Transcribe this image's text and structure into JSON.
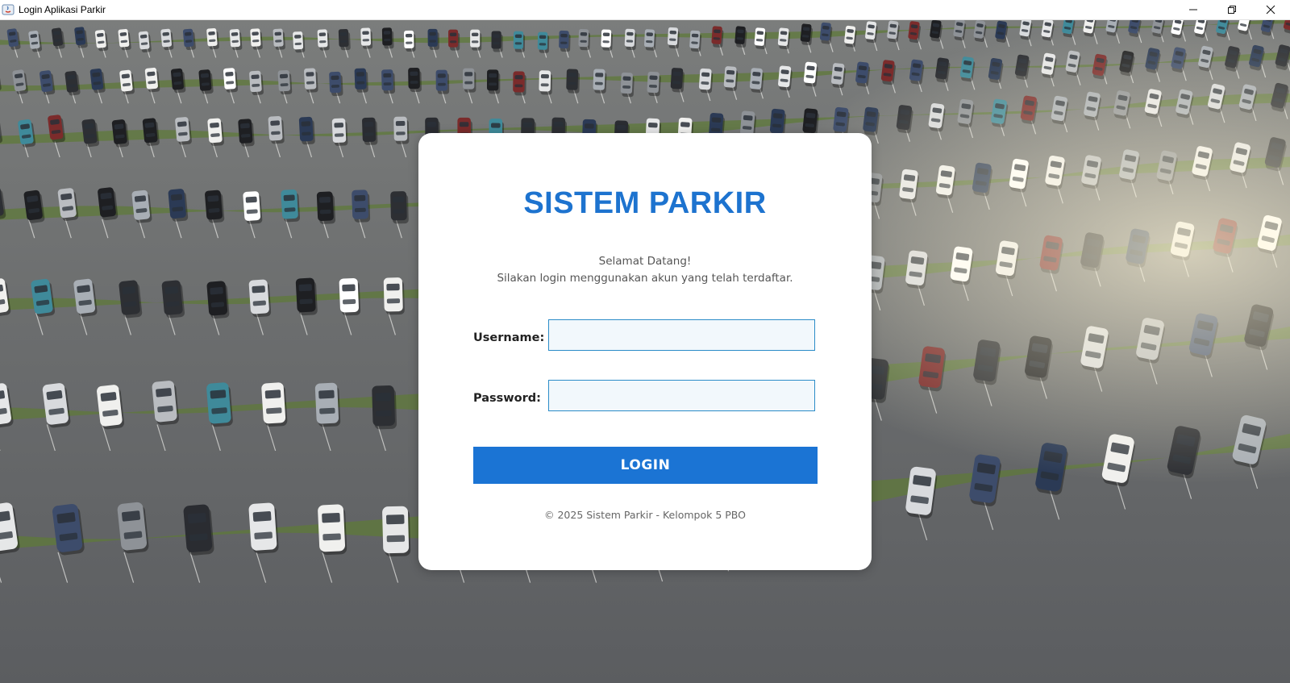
{
  "window": {
    "title": "Login Aplikasi Parkir",
    "icons": {
      "app": "java-app-icon",
      "minimize": "minimize-icon",
      "maximize": "restore-icon",
      "close": "close-icon"
    }
  },
  "background": {
    "description_icon": "parking-lot-photo"
  },
  "login": {
    "title": "SISTEM PARKIR",
    "welcome_line1": "Selamat Datang!",
    "welcome_line2": "Silakan login menggunakan akun yang telah terdaftar.",
    "username_label": "Username:",
    "username_value": "",
    "password_label": "Password:",
    "password_value": "",
    "login_button": "LOGIN",
    "footer": "© 2025 Sistem Parkir - Kelompok 5 PBO"
  },
  "colors": {
    "accent": "#1b74d4",
    "title": "#1d73cf",
    "input_border": "#2b8cc8",
    "input_bg": "#f2f8fc",
    "card_bg": "#ffffff"
  }
}
